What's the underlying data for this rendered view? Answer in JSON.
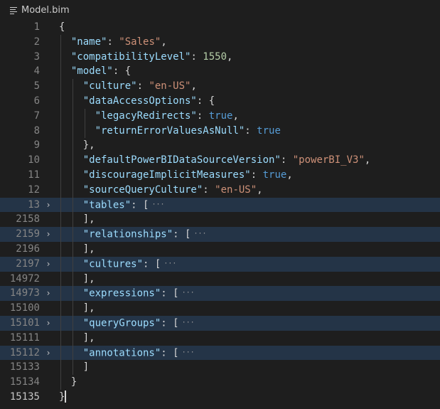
{
  "tab": {
    "title": "Model.bim",
    "icon": "file-lines-icon"
  },
  "lines": [
    {
      "num": "1",
      "indent": 0,
      "tokens": [
        [
          "p",
          "{"
        ]
      ]
    },
    {
      "num": "2",
      "indent": 1,
      "tokens": [
        [
          "k",
          "\"name\""
        ],
        [
          "p",
          ": "
        ],
        [
          "s",
          "\"Sales\""
        ],
        [
          "p",
          ","
        ]
      ]
    },
    {
      "num": "3",
      "indent": 1,
      "tokens": [
        [
          "k",
          "\"compatibilityLevel\""
        ],
        [
          "p",
          ": "
        ],
        [
          "n",
          "1550"
        ],
        [
          "p",
          ","
        ]
      ]
    },
    {
      "num": "4",
      "indent": 1,
      "tokens": [
        [
          "k",
          "\"model\""
        ],
        [
          "p",
          ": {"
        ]
      ]
    },
    {
      "num": "5",
      "indent": 2,
      "tokens": [
        [
          "k",
          "\"culture\""
        ],
        [
          "p",
          ": "
        ],
        [
          "s",
          "\"en-US\""
        ],
        [
          "p",
          ","
        ]
      ]
    },
    {
      "num": "6",
      "indent": 2,
      "tokens": [
        [
          "k",
          "\"dataAccessOptions\""
        ],
        [
          "p",
          ": {"
        ]
      ]
    },
    {
      "num": "7",
      "indent": 3,
      "tokens": [
        [
          "k",
          "\"legacyRedirects\""
        ],
        [
          "p",
          ": "
        ],
        [
          "b",
          "true"
        ],
        [
          "p",
          ","
        ]
      ]
    },
    {
      "num": "8",
      "indent": 3,
      "tokens": [
        [
          "k",
          "\"returnErrorValuesAsNull\""
        ],
        [
          "p",
          ": "
        ],
        [
          "b",
          "true"
        ]
      ]
    },
    {
      "num": "9",
      "indent": 2,
      "tokens": [
        [
          "p",
          "},"
        ]
      ]
    },
    {
      "num": "10",
      "indent": 2,
      "tokens": [
        [
          "k",
          "\"defaultPowerBIDataSourceVersion\""
        ],
        [
          "p",
          ": "
        ],
        [
          "s",
          "\"powerBI_V3\""
        ],
        [
          "p",
          ","
        ]
      ]
    },
    {
      "num": "11",
      "indent": 2,
      "tokens": [
        [
          "k",
          "\"discourageImplicitMeasures\""
        ],
        [
          "p",
          ": "
        ],
        [
          "b",
          "true"
        ],
        [
          "p",
          ","
        ]
      ]
    },
    {
      "num": "12",
      "indent": 2,
      "tokens": [
        [
          "k",
          "\"sourceQueryCulture\""
        ],
        [
          "p",
          ": "
        ],
        [
          "s",
          "\"en-US\""
        ],
        [
          "p",
          ","
        ]
      ]
    },
    {
      "num": "13",
      "indent": 2,
      "folded": true,
      "tokens": [
        [
          "k",
          "\"tables\""
        ],
        [
          "p",
          ": ["
        ]
      ]
    },
    {
      "num": "2158",
      "indent": 2,
      "tokens": [
        [
          "p",
          "],"
        ]
      ]
    },
    {
      "num": "2159",
      "indent": 2,
      "folded": true,
      "tokens": [
        [
          "k",
          "\"relationships\""
        ],
        [
          "p",
          ": ["
        ]
      ]
    },
    {
      "num": "2196",
      "indent": 2,
      "tokens": [
        [
          "p",
          "],"
        ]
      ]
    },
    {
      "num": "2197",
      "indent": 2,
      "folded": true,
      "tokens": [
        [
          "k",
          "\"cultures\""
        ],
        [
          "p",
          ": ["
        ]
      ]
    },
    {
      "num": "14972",
      "indent": 2,
      "tokens": [
        [
          "p",
          "],"
        ]
      ]
    },
    {
      "num": "14973",
      "indent": 2,
      "folded": true,
      "tokens": [
        [
          "k",
          "\"expressions\""
        ],
        [
          "p",
          ": ["
        ]
      ]
    },
    {
      "num": "15100",
      "indent": 2,
      "tokens": [
        [
          "p",
          "],"
        ]
      ]
    },
    {
      "num": "15101",
      "indent": 2,
      "folded": true,
      "tokens": [
        [
          "k",
          "\"queryGroups\""
        ],
        [
          "p",
          ": ["
        ]
      ]
    },
    {
      "num": "15111",
      "indent": 2,
      "tokens": [
        [
          "p",
          "],"
        ]
      ]
    },
    {
      "num": "15112",
      "indent": 2,
      "folded": true,
      "tokens": [
        [
          "k",
          "\"annotations\""
        ],
        [
          "p",
          ": ["
        ]
      ]
    },
    {
      "num": "15133",
      "indent": 2,
      "tokens": [
        [
          "p",
          "]"
        ]
      ]
    },
    {
      "num": "15134",
      "indent": 1,
      "tokens": [
        [
          "p",
          "}"
        ]
      ]
    },
    {
      "num": "15135",
      "indent": 0,
      "current": true,
      "cursor": true,
      "tokens": [
        [
          "p",
          "}"
        ]
      ]
    }
  ],
  "fold_marker": "›",
  "ellipsis": "···"
}
